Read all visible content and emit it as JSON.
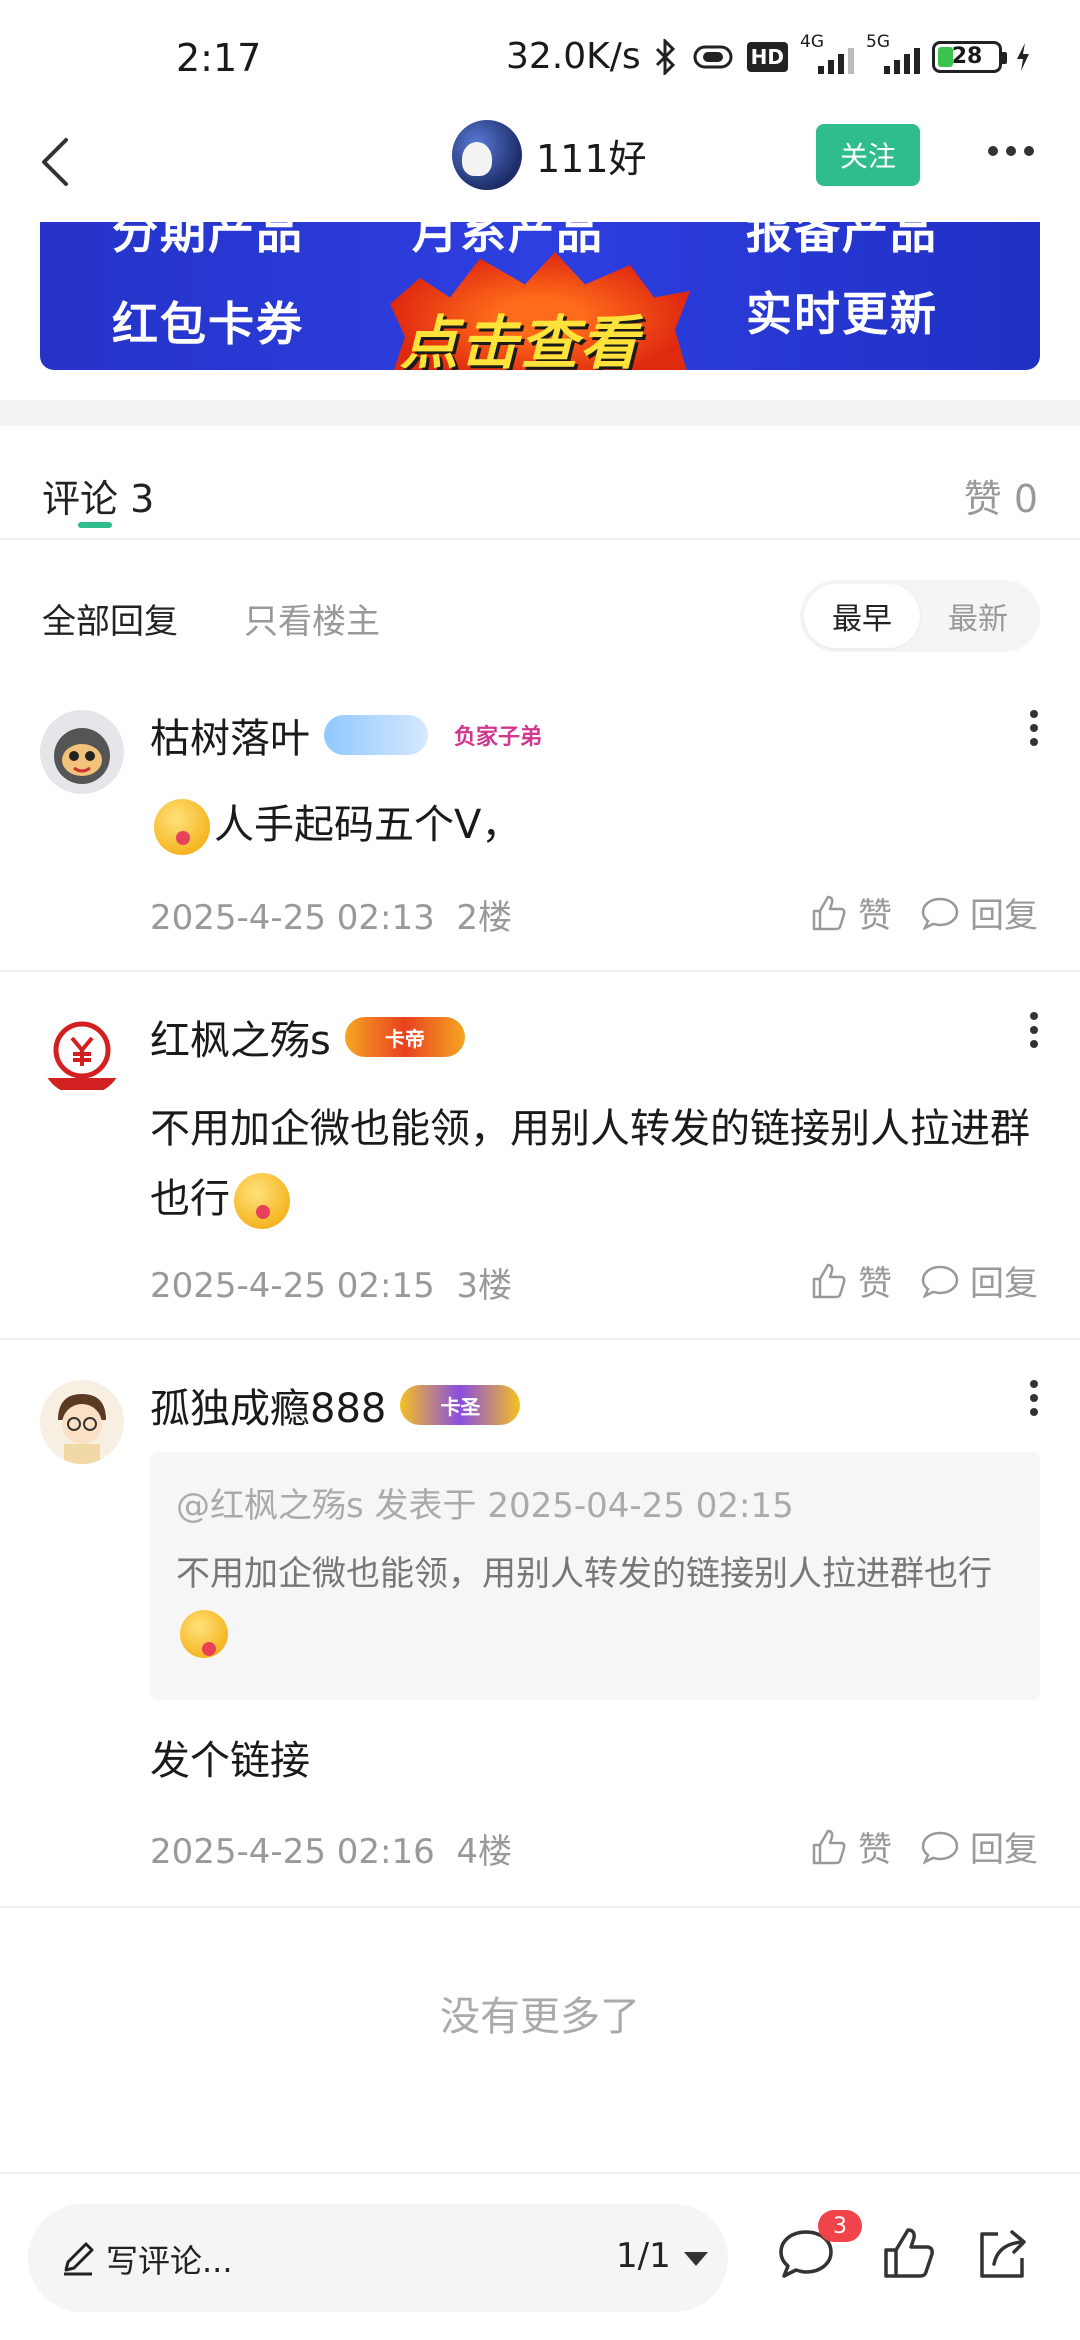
{
  "status_bar": {
    "time": "2:17",
    "speed": "32.0K/s",
    "network_1": "4G",
    "network_2": "5G",
    "hd_label": "HD",
    "battery": "28"
  },
  "nav": {
    "username": "111好",
    "follow_label": "关注"
  },
  "banner": {
    "left_top": "分期产品",
    "left_bottom": "红包卡券",
    "mid_top": "月系产品",
    "cta": "点击查看",
    "right_top": "报备产品",
    "right_bottom": "实时更新"
  },
  "tabs": {
    "comments_label": "评论 3",
    "likes_label": "赞 0"
  },
  "filter": {
    "all_label": "全部回复",
    "op_only_label": "只看楼主",
    "sort_earliest": "最早",
    "sort_latest": "最新"
  },
  "comments": [
    {
      "name": "枯树落叶",
      "badges": [
        "",
        "负家子弟"
      ],
      "text": "人手起码五个V，",
      "time": "2025-4-25 02:13",
      "floor": "2楼",
      "like_label": "赞",
      "reply_label": "回复"
    },
    {
      "name": "红枫之殇s",
      "badges": [
        "卡帝"
      ],
      "text": "不用加企微也能领，用别人转发的链接别人拉进群也行",
      "time": "2025-4-25 02:15",
      "floor": "3楼",
      "like_label": "赞",
      "reply_label": "回复"
    },
    {
      "name": "孤独成瘾888",
      "badges": [
        "卡圣"
      ],
      "quote_head": "@红枫之殇s 发表于 2025-04-25 02:15",
      "quote_text": "不用加企微也能领，用别人转发的链接别人拉进群也行",
      "text": "发个链接",
      "time": "2025-4-25 02:16",
      "floor": "4楼",
      "like_label": "赞",
      "reply_label": "回复"
    }
  ],
  "no_more": "没有更多了",
  "bottom_bar": {
    "write_placeholder": "写评论...",
    "page": "1/1",
    "comment_count": "3"
  },
  "colors": {
    "accent": "#2fbd8b",
    "badge_red": "#f0434a",
    "banner_blue": "#2d3fe0"
  }
}
